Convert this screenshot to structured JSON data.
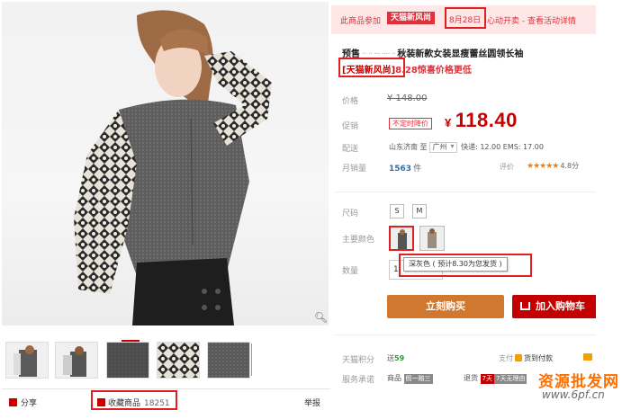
{
  "promo": {
    "prefix": "此商品参加",
    "tag": "天猫新风尚",
    "date": "8月28日",
    "suffix": "心动开卖 - 查看活动详情"
  },
  "title": {
    "line1_prefix": "预售",
    "line1_suffix": "秋装新款女装显瘦蕾丝圆领长袖",
    "line2_bracket": "[天猫新风尚]",
    "line2_date": "8.28",
    "line2_rest": "惊喜价格更低"
  },
  "labels": {
    "price": "价格",
    "promo_price": "促销",
    "delivery": "配送",
    "monthly_sales": "月销量",
    "reviews": "评价",
    "size": "尺码",
    "color": "主要颜色",
    "quantity": "数量",
    "points": "天猫积分",
    "payment": "支付",
    "service": "服务承诺"
  },
  "price": {
    "original": "¥ 148.00",
    "sale_tag": "不定时降价",
    "currency": "¥",
    "current": "118.40"
  },
  "delivery": {
    "from": "山东济南",
    "to_word": "至",
    "city": "广州",
    "fee": "快递: 12.00 EMS: 17.00"
  },
  "sales": {
    "count": "1563",
    "unit": "件"
  },
  "rating": {
    "stars": 5,
    "score": "4.8分"
  },
  "sizes": [
    "S",
    "M"
  ],
  "quantity": "1",
  "tooltip": "深灰色 ( 预计8.30为您发货 )",
  "buttons": {
    "buy": "立刻购买",
    "cart": "加入购物车"
  },
  "points": {
    "prefix": "送",
    "value": "59"
  },
  "payment": {
    "cod": "货到付款"
  },
  "service": {
    "item_prefix": "商品",
    "tag1": "假一赔三",
    "refund": "退货",
    "tag2": "7天",
    "tag3": "7天无理由"
  },
  "gallery": {
    "share": "分享",
    "collect": "收藏商品",
    "collect_count": "18251",
    "report": "举报"
  },
  "watermark": {
    "line1": "资源批发网",
    "line2": "www.6pf.cn"
  }
}
